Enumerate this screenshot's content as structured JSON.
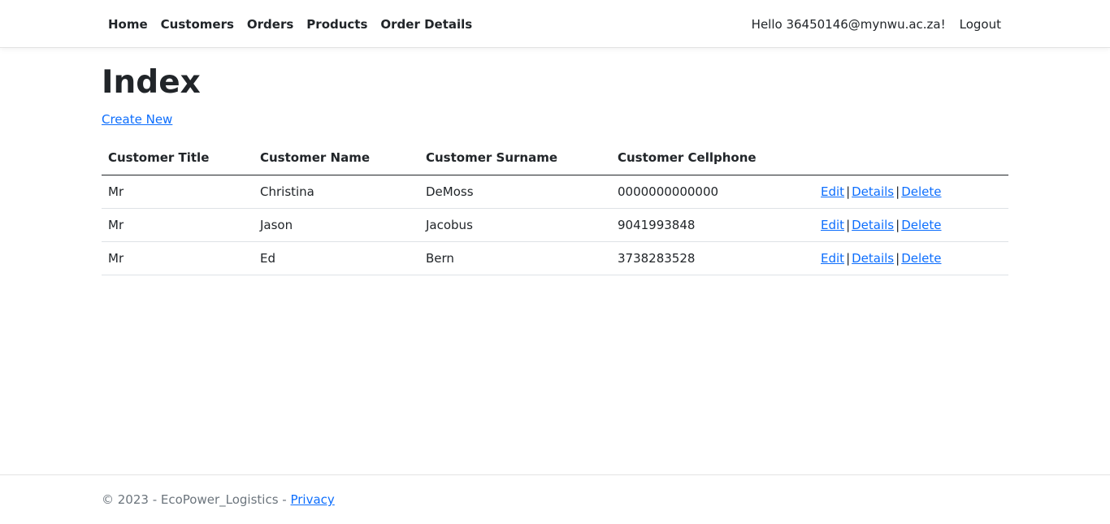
{
  "nav": {
    "links": [
      "Home",
      "Customers",
      "Orders",
      "Products",
      "Order Details"
    ],
    "greeting": "Hello 36450146@mynwu.ac.za!",
    "logout": "Logout"
  },
  "main": {
    "title": "Index",
    "create_new": "Create New",
    "table": {
      "headers": [
        "Customer Title",
        "Customer Name",
        "Customer Surname",
        "Customer Cellphone",
        ""
      ],
      "rows": [
        {
          "title": "Mr",
          "name": "Christina",
          "surname": "DeMoss",
          "cellphone": "0000000000000"
        },
        {
          "title": "Mr",
          "name": "Jason",
          "surname": "Jacobus",
          "cellphone": "9041993848"
        },
        {
          "title": "Mr",
          "name": "Ed",
          "surname": "Bern",
          "cellphone": "3738283528"
        }
      ],
      "actions": {
        "edit": "Edit",
        "details": "Details",
        "delete": "Delete",
        "separator": "|"
      }
    }
  },
  "footer": {
    "text": "© 2023 - EcoPower_Logistics - ",
    "privacy": "Privacy"
  },
  "colors": {
    "link": "#0d6efd",
    "text": "#212529",
    "muted": "#6c757d"
  }
}
